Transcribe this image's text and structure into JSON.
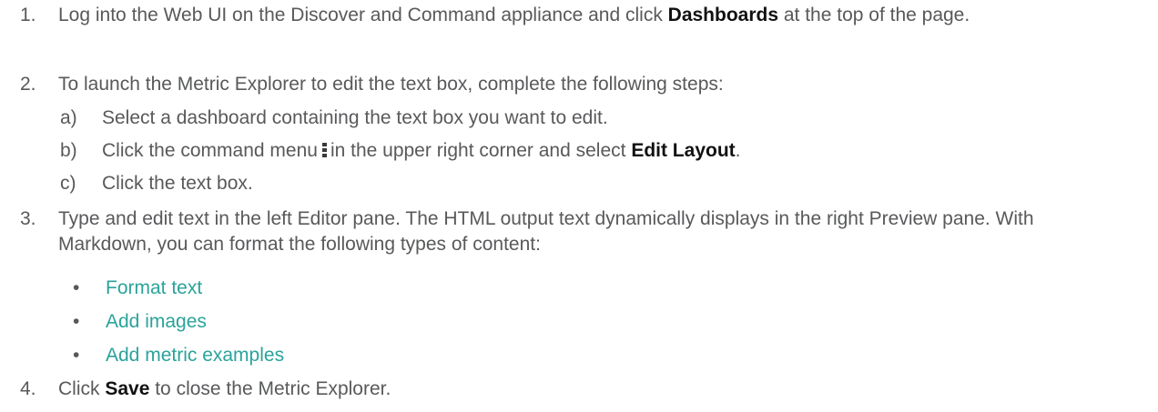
{
  "steps": [
    {
      "num": "1.",
      "pre": "Log into the Web UI on the Discover and Command appliance and click ",
      "bold": "Dashboards",
      "post": " at the top of the page."
    },
    {
      "num": "2.",
      "text": "To launch the Metric Explorer to edit the text box, complete the following steps:",
      "substeps": [
        {
          "letter": "a)",
          "text": "Select a dashboard containing the text box you want to edit."
        },
        {
          "letter": "b)",
          "pre": "Click the command menu",
          "icon": "vertical-ellipsis-icon",
          "mid": "in the upper right corner and select ",
          "bold": "Edit Layout",
          "post": "."
        },
        {
          "letter": "c)",
          "text": "Click the text box."
        }
      ]
    },
    {
      "num": "3.",
      "text": "Type and edit text in the left Editor pane. The HTML output text dynamically displays in the right Preview pane. With Markdown, you can format the following types of content:",
      "bullet": "•",
      "links": [
        "Format text",
        "Add images",
        "Add metric examples"
      ]
    },
    {
      "num": "4.",
      "pre": "Click ",
      "bold": "Save",
      "post": " to close the Metric Explorer."
    }
  ],
  "colors": {
    "text": "#58595b",
    "link": "#2aa39a",
    "bold": "#111111"
  }
}
